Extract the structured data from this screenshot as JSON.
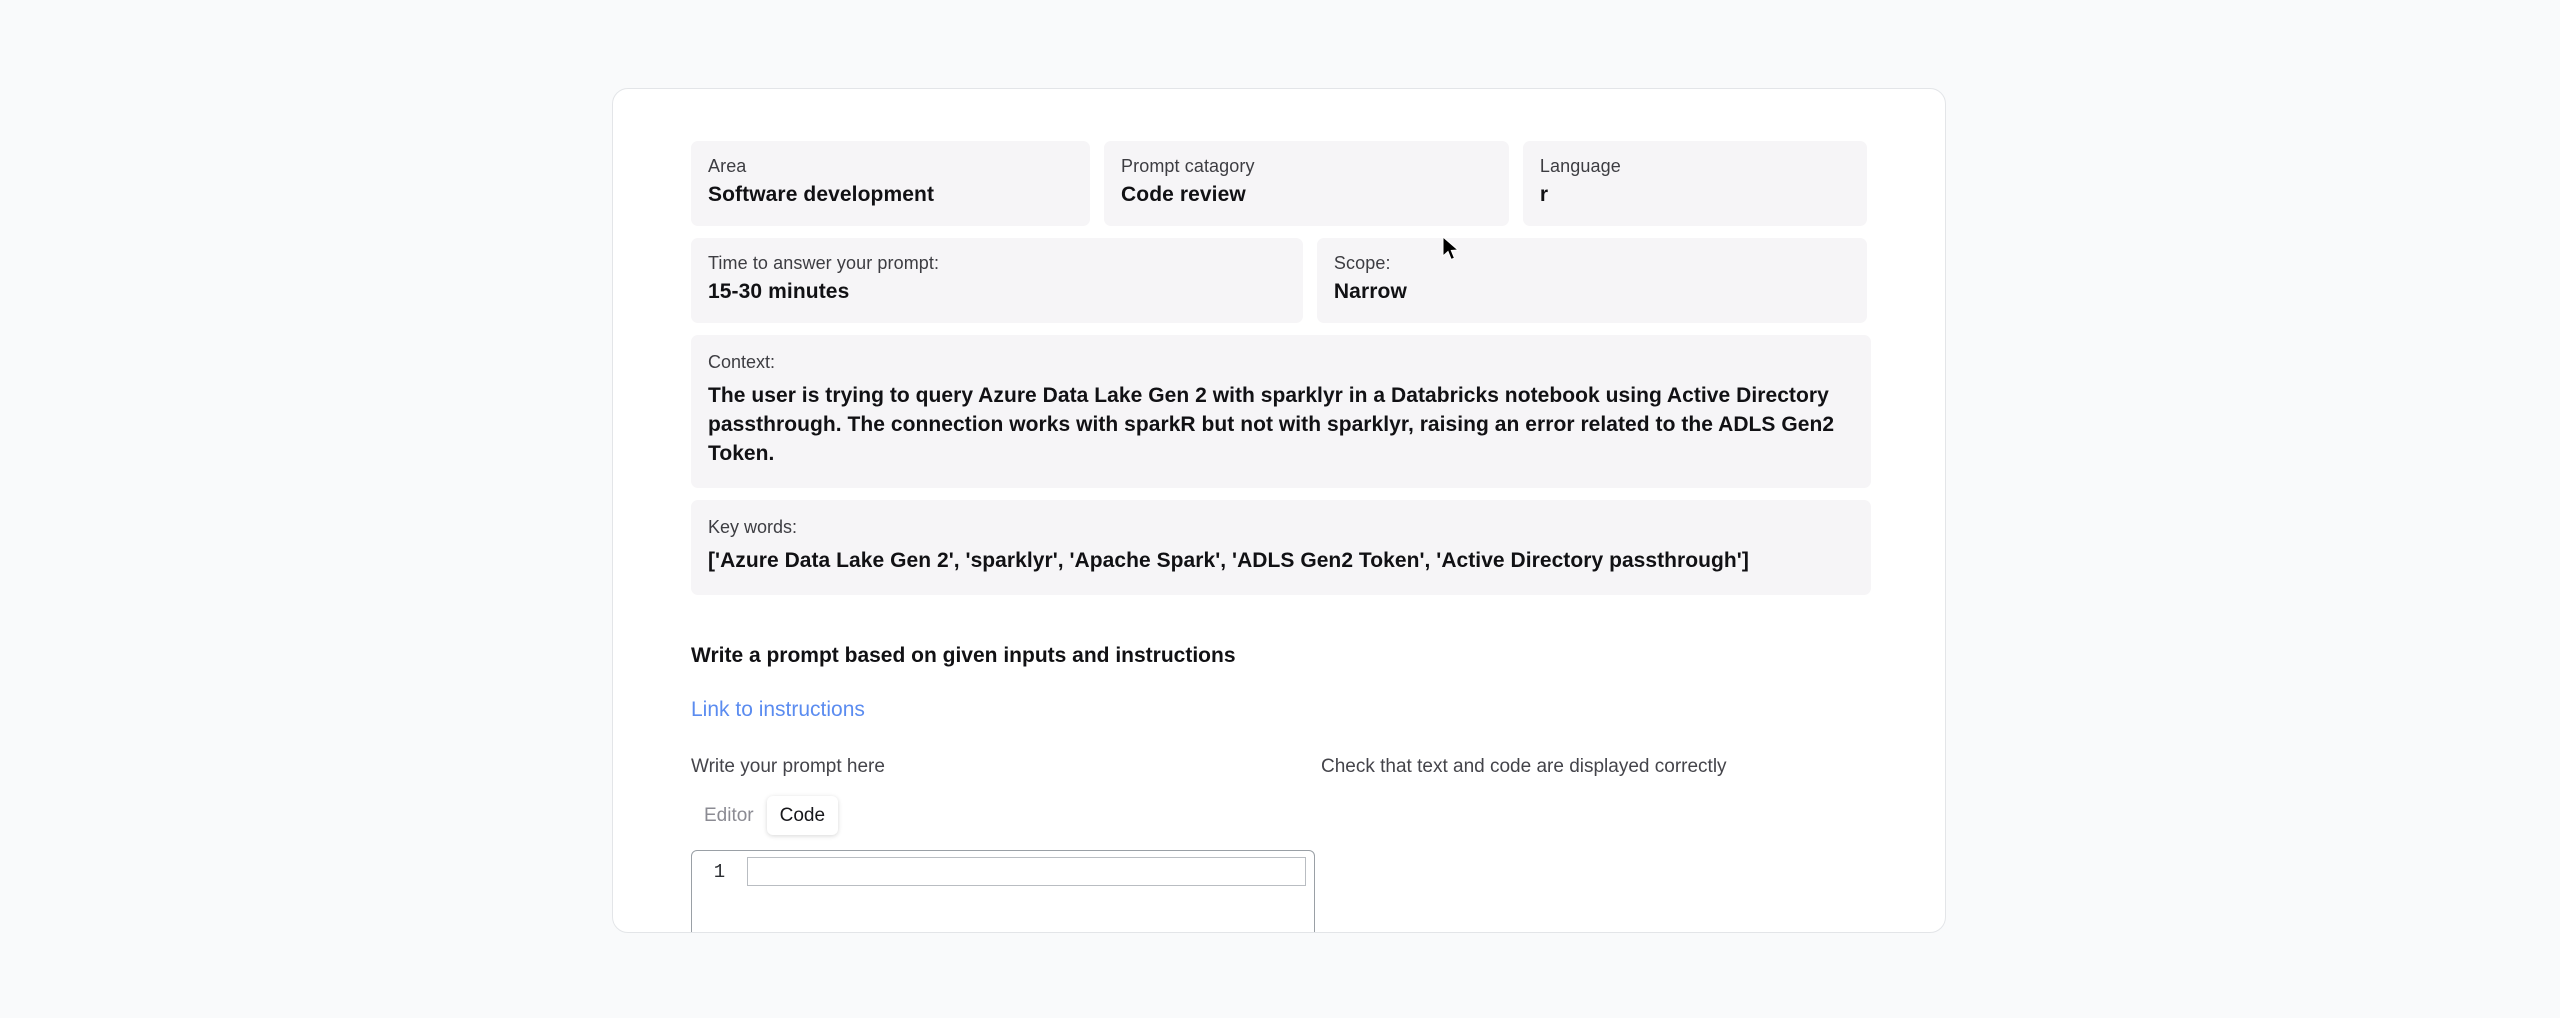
{
  "fields": {
    "row1": [
      {
        "label": "Area",
        "value": "Software development",
        "name": "area"
      },
      {
        "label": "Prompt catagory",
        "value": "Code review",
        "name": "prompt-category"
      },
      {
        "label": "Language",
        "value": "r",
        "name": "language"
      }
    ],
    "row2": [
      {
        "label": "Time to answer your prompt:",
        "value": "15-30 minutes",
        "name": "time-to-answer"
      },
      {
        "label": "Scope:",
        "value": "Narrow",
        "name": "scope"
      }
    ],
    "context": {
      "label": "Context:",
      "value": "The user is trying to query Azure Data Lake Gen 2 with sparklyr in a Databricks notebook using Active Directory passthrough. The connection works with sparkR but not with sparklyr, raising an error related to the ADLS Gen2 Token."
    },
    "keywords": {
      "label": "Key words:",
      "value": "['Azure Data Lake Gen 2', 'sparklyr', 'Apache Spark', 'ADLS Gen2 Token', 'Active Directory passthrough']",
      "items": [
        "Azure Data Lake Gen 2",
        "sparklyr",
        "Apache Spark",
        "ADLS Gen2 Token",
        "Active Directory passthrough"
      ]
    }
  },
  "instructions": {
    "heading": "Write a prompt based on given inputs and instructions",
    "link_label": "Link to instructions"
  },
  "editor": {
    "left_label": "Write your prompt here",
    "right_label": "Check that text and code are displayed correctly",
    "tabs": [
      {
        "label": "Editor",
        "active": false
      },
      {
        "label": "Code",
        "active": true
      }
    ],
    "line_numbers": [
      "1"
    ],
    "code_value": ""
  },
  "colors": {
    "page_background": "#f9fafb",
    "card_background": "#ffffff",
    "field_background": "#f6f5f7",
    "link": "#5b8cf0",
    "text_primary": "#111114",
    "text_secondary": "#3d3d42",
    "tab_inactive": "#8b8b93"
  }
}
